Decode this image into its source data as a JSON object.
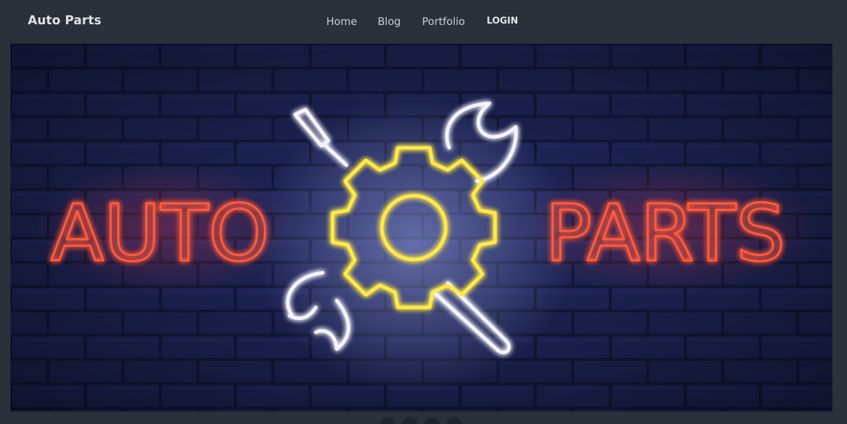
{
  "nav": {
    "brand": "Auto Parts",
    "links": [
      "Home",
      "Blog",
      "Portfolio"
    ],
    "login": "LOGIN"
  },
  "hero": {
    "left_word": "AUTO",
    "right_word": "PARTS"
  },
  "carousel": {
    "slide_count": 4
  },
  "colors": {
    "navbar": "#2a313b",
    "wall": "#1c2350",
    "neon_red": "#ff5a3c",
    "neon_yellow": "#ffe94a",
    "neon_white": "#f4f4ff"
  }
}
